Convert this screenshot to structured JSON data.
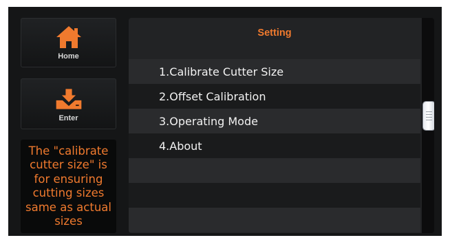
{
  "left_panel": {
    "home_label": "Home",
    "enter_label": "Enter",
    "info_text": "The \"calibrate cutter size\" is for ensuring cutting sizes same as actual sizes"
  },
  "settings": {
    "title": "Setting",
    "items": [
      {
        "label": "1.Calibrate Cutter Size"
      },
      {
        "label": "2.Offset Calibration"
      },
      {
        "label": "3.Operating Mode"
      },
      {
        "label": "4.About"
      },
      {
        "label": ""
      },
      {
        "label": ""
      },
      {
        "label": ""
      }
    ]
  },
  "icons": {
    "home": "home-icon",
    "enter": "enter-icon"
  },
  "colors": {
    "accent": "#f07a2e",
    "screen_bg": "#151617",
    "panel_bg": "#222325",
    "row_light": "#2a2b2d",
    "row_dark": "#1a1b1c",
    "text": "#f2f2f2"
  }
}
